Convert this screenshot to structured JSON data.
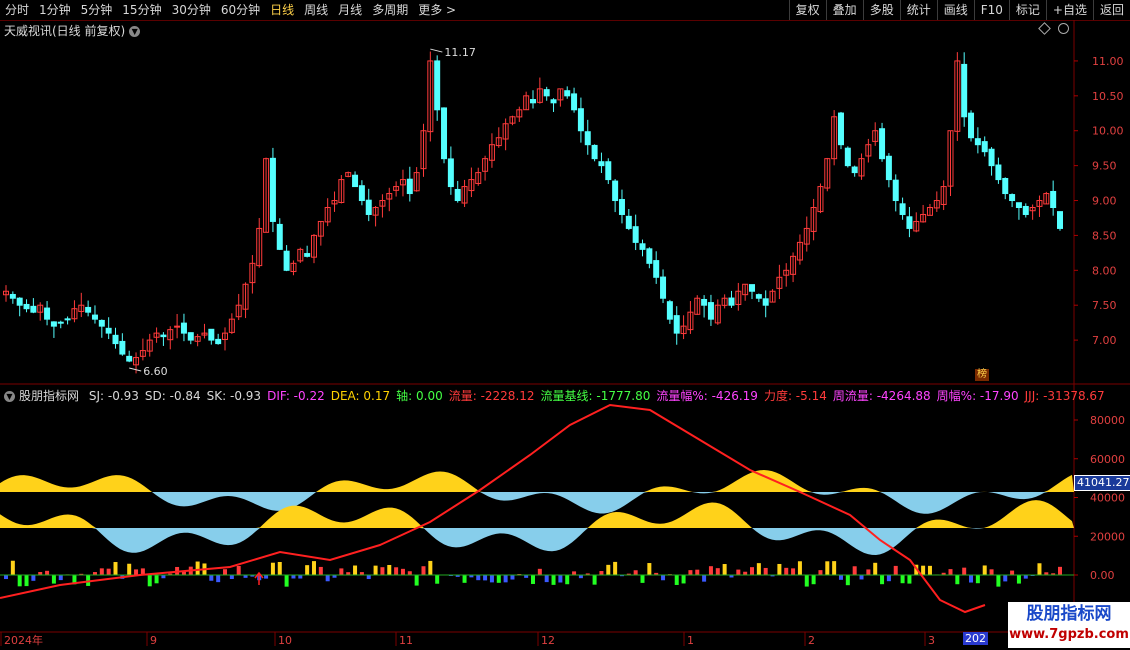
{
  "toolbar": {
    "periods": [
      "分时",
      "1分钟",
      "5分钟",
      "15分钟",
      "30分钟",
      "60分钟",
      "日线",
      "周线",
      "月线",
      "多周期",
      "更多 >"
    ],
    "active_period": "日线",
    "actions": [
      "复权",
      "叠加",
      "多股",
      "统计",
      "画线",
      "F10",
      "标记",
      "+自选",
      "返回"
    ]
  },
  "chart": {
    "title": "天威视讯(日线 前复权)",
    "price_ticks": [
      "11.00",
      "10.50",
      "10.00",
      "9.50",
      "9.00",
      "8.50",
      "8.00",
      "7.50",
      "7.00"
    ],
    "high_label": "11.17",
    "low_label": "6.60",
    "badge": "榜",
    "up_color": "#ff3b3b",
    "down_color": "#54ffff"
  },
  "indicator": {
    "name": "股朋指标网",
    "items": [
      {
        "label": "SJ: -0.93",
        "color": "#d8d8d8"
      },
      {
        "label": "SD: -0.84",
        "color": "#d8d8d8"
      },
      {
        "label": "SK: -0.93",
        "color": "#d8d8d8"
      },
      {
        "label": "DIF: -0.22",
        "color": "#ff44ff"
      },
      {
        "label": "DEA: 0.17",
        "color": "#ffd200"
      },
      {
        "label": "轴: 0.00",
        "color": "#44ff44"
      },
      {
        "label": "流量: -2228.12",
        "color": "#ff3b3b"
      },
      {
        "label": "流量基线: -1777.80",
        "color": "#44ff44"
      },
      {
        "label": "流量幅%: -426.19",
        "color": "#ff44ff"
      },
      {
        "label": "力度: -5.14",
        "color": "#ff3b3b"
      },
      {
        "label": "周流量: -4264.88",
        "color": "#ff44ff"
      },
      {
        "label": "周幅%: -17.90",
        "color": "#ff44ff"
      },
      {
        "label": "JJJ: -31378.67",
        "color": "#ff3b3b"
      }
    ],
    "ticks": [
      "80000",
      "60000",
      "40000",
      "20000",
      "0.00"
    ],
    "current_label": "41041.27"
  },
  "xaxis": {
    "labels": [
      "2024年",
      "9",
      "10",
      "11",
      "12",
      "1",
      "2",
      "3"
    ],
    "last_label": "202"
  },
  "watermark": {
    "line1": "股朋指标网",
    "line2": "www.7gpzb.com"
  },
  "chart_data": {
    "type": "candlestick",
    "title": "天威视讯(日线 前复权)",
    "ylim": [
      6.5,
      11.3
    ],
    "closes": [
      7.7,
      7.6,
      7.5,
      7.45,
      7.4,
      7.5,
      7.3,
      7.2,
      7.25,
      7.3,
      7.45,
      7.5,
      7.4,
      7.3,
      7.2,
      7.1,
      6.95,
      6.8,
      6.7,
      6.75,
      6.85,
      7.0,
      7.1,
      7.05,
      7.15,
      7.2,
      7.1,
      7.0,
      7.05,
      7.1,
      7.0,
      6.95,
      7.1,
      7.3,
      7.5,
      7.8,
      8.1,
      8.6,
      9.6,
      8.7,
      8.3,
      8.0,
      8.1,
      8.3,
      8.2,
      8.5,
      8.7,
      8.9,
      9.0,
      9.3,
      9.4,
      9.2,
      9.0,
      8.8,
      8.9,
      9.0,
      9.1,
      9.2,
      9.3,
      9.1,
      9.4,
      10.0,
      11.0,
      10.3,
      9.6,
      9.2,
      9.0,
      9.2,
      9.3,
      9.4,
      9.6,
      9.8,
      9.9,
      10.1,
      10.2,
      10.3,
      10.5,
      10.4,
      10.6,
      10.5,
      10.4,
      10.6,
      10.5,
      10.3,
      10.0,
      9.8,
      9.6,
      9.5,
      9.3,
      9.0,
      8.8,
      8.6,
      8.4,
      8.3,
      8.1,
      7.9,
      7.6,
      7.3,
      7.1,
      7.2,
      7.4,
      7.6,
      7.5,
      7.3,
      7.5,
      7.6,
      7.5,
      7.7,
      7.8,
      7.7,
      7.6,
      7.5,
      7.7,
      7.9,
      8.0,
      8.2,
      8.4,
      8.6,
      8.9,
      9.2,
      9.6,
      10.2,
      9.8,
      9.5,
      9.4,
      9.6,
      9.8,
      10.0,
      9.6,
      9.3,
      9.0,
      8.8,
      8.6,
      8.7,
      8.8,
      8.9,
      9.0,
      9.2,
      10.0,
      11.0,
      10.2,
      9.9,
      9.8,
      9.7,
      9.5,
      9.3,
      9.1,
      9.0,
      8.9,
      8.8,
      8.9,
      9.0,
      9.1,
      8.9,
      8.6
    ]
  }
}
